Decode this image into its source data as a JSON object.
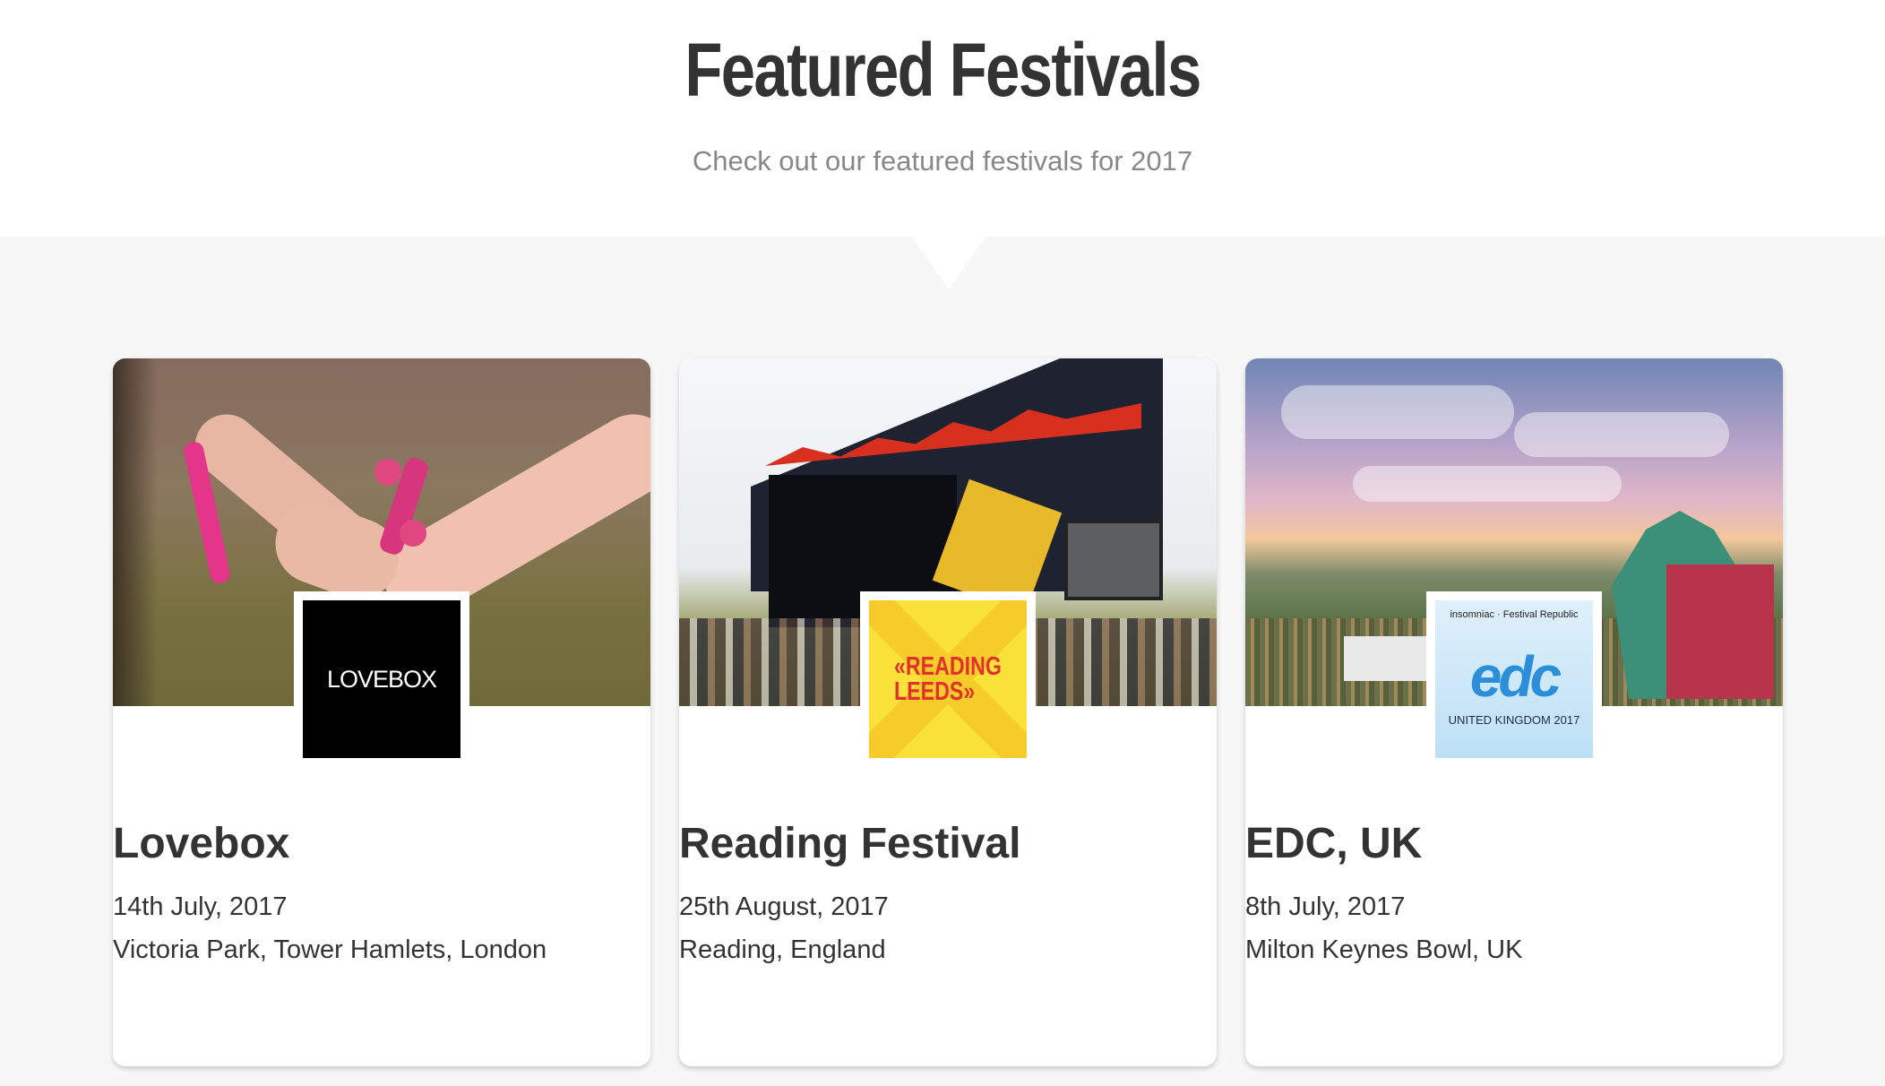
{
  "header": {
    "title": "Featured Festivals",
    "subtitle": "Check out our featured festivals for 2017"
  },
  "festivals": [
    {
      "name": "Lovebox",
      "date": "14th July, 2017",
      "location": "Victoria Park, Tower Hamlets, London",
      "logo_text": "LOVEBOX"
    },
    {
      "name": "Reading Festival",
      "date": "25th August, 2017",
      "location": "Reading, England",
      "logo_text_line1": "«READING",
      "logo_text_line2": "LEEDS»"
    },
    {
      "name": "EDC, UK",
      "date": "8th July, 2017",
      "location": "Milton Keynes Bowl, UK",
      "logo_top": "insomniac · Festival Republic",
      "logo_mark": "edc",
      "logo_sub": "UNITED KINGDOM 2017"
    }
  ],
  "colors": {
    "title": "#333333",
    "subtitle": "#888888",
    "section_background": "#f7f7f7",
    "card_background": "#ffffff"
  }
}
